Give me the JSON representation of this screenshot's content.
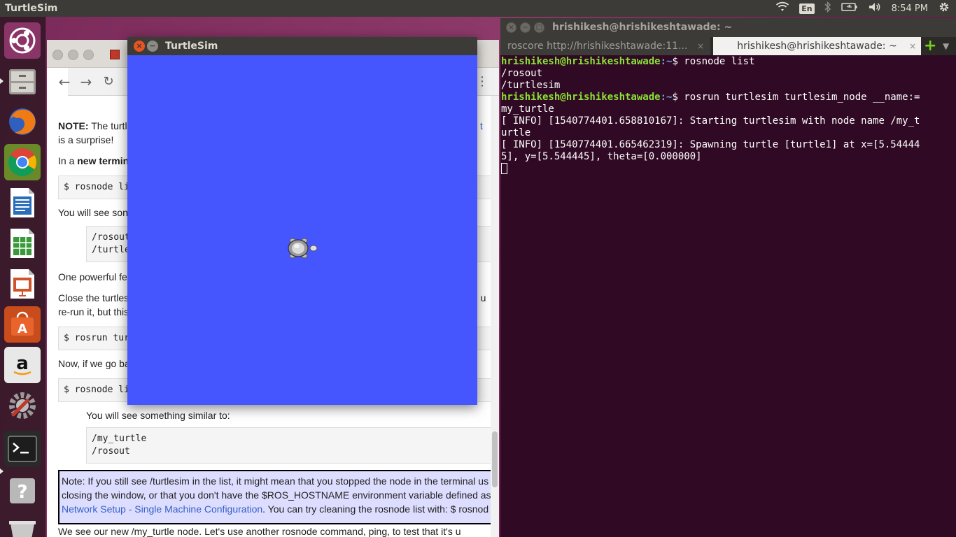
{
  "top_panel": {
    "app_title": "TurtleSim",
    "lang": "En",
    "clock": "8:54 PM"
  },
  "launcher": {
    "items": [
      "ubuntu-dash",
      "files",
      "firefox",
      "chrome",
      "libreoffice-writer",
      "libreoffice-calc",
      "libreoffice-impress",
      "ubuntu-software",
      "amazon",
      "system-settings",
      "terminal",
      "help",
      "trash"
    ]
  },
  "browser": {
    "content": {
      "note_bold": "NOTE:",
      "note_rest": " The turtl",
      "note_right": "y t",
      "surprise": "is a surprise!",
      "in_a": "In a ",
      "new_term": "new termin",
      "cmd1": "$ rosnode li",
      "you_will_see": "You will see son",
      "pre1_line1": "/rosout",
      "pre1_line2": "/turtle",
      "one_powerful": "One powerful fe",
      "close_turtles": "Close the turtles",
      "close_right": "d u",
      "rerun": "re-run it, but this",
      "cmd2": "$ rosrun tur",
      "now_if": "Now, if we go ba",
      "cmd3": "$ rosnode li",
      "similar": "You will see something similar to:",
      "pre2_line1": "/my_turtle",
      "pre2_line2": "/rosout",
      "note_box_line1": "Note: If you still see /turtlesim in the list, it might mean that you stopped the node in the terminal us",
      "note_box_line2": "closing the window, or that you don't have the $ROS_HOSTNAME environment variable defined as",
      "note_box_link": "Network Setup - Single Machine Configuration",
      "note_box_line3_rest": ". You can try cleaning the rosnode list with: $ rosnod",
      "bottom_line": "We see our new /my_turtle node. Let's use another rosnode command, ping, to test that it's u"
    }
  },
  "turtlesim": {
    "title": "TurtleSim",
    "background_color": "#4556ff"
  },
  "terminal": {
    "title": "hrishikesh@hrishikeshtawade: ~",
    "tabs": [
      {
        "label": "roscore http://hrishikeshtawade:11...",
        "active": false
      },
      {
        "label": "hrishikesh@hrishikeshtawade: ~",
        "active": true
      }
    ],
    "lines": {
      "p1_user": "hrishikesh@hrishikeshtawade",
      "p1_path": ":~",
      "p1_cmd": "$ rosnode list",
      "out1": "/rosout",
      "out2": "/turtlesim",
      "p2_user": "hrishikesh@hrishikeshtawade",
      "p2_path": ":~",
      "p2_cmd": "$ rosrun turtlesim turtlesim_node __name:=",
      "p2_cont": "my_turtle",
      "info1a": "[ INFO] [1540774401.658810167]: Starting turtlesim with node name /my_t",
      "info1b": "urtle",
      "info2a": "[ INFO] [1540774401.665462319]: Spawning turtle [turtle1] at x=[5.54444",
      "info2b": "5], y=[5.544445], theta=[0.000000]"
    }
  }
}
